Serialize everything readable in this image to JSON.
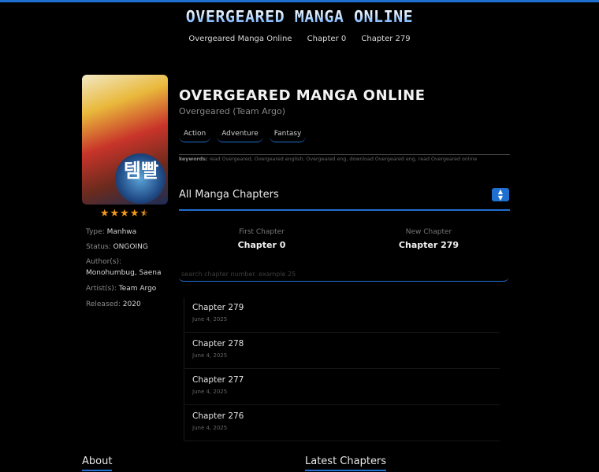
{
  "site": {
    "logo": "OVERGEARED MANGA ONLINE"
  },
  "nav": [
    "Overgeared Manga Online",
    "Chapter 0",
    "Chapter 279"
  ],
  "manga": {
    "title": "OVERGEARED MANGA ONLINE",
    "subtitle": "Overgeared (Team Argo)",
    "cover_text": "템빨",
    "rating_stars": 4.5,
    "genres": [
      "Action",
      "Adventure",
      "Fantasy"
    ],
    "keywords_label": "keywords:",
    "keywords": "read Overgeared, Overgeared english, Overgeared eng, download Overgeared eng, read Overgeared online"
  },
  "meta": {
    "type_label": "Type:",
    "type": "Manhwa",
    "status_label": "Status:",
    "status": "ONGOING",
    "author_label": "Author(s):",
    "author": "Monohumbug, Saena",
    "artist_label": "Artist(s):",
    "artist": "Team Argo",
    "released_label": "Released:",
    "released": "2020"
  },
  "chapters": {
    "heading": "All Manga Chapters",
    "first_label": "First Chapter",
    "first": "Chapter 0",
    "new_label": "New Chapter",
    "new": "Chapter 279",
    "search_placeholder": "search chapter number. example 25",
    "list": [
      {
        "name": "Chapter 279",
        "date": "June 4, 2025"
      },
      {
        "name": "Chapter 278",
        "date": "June 4, 2025"
      },
      {
        "name": "Chapter 277",
        "date": "June 4, 2025"
      },
      {
        "name": "Chapter 276",
        "date": "June 4, 2025"
      }
    ]
  },
  "footer": {
    "about": "About",
    "latest": "Latest Chapters"
  },
  "colors": {
    "accent": "#1f6fd1",
    "star": "#f39a1c",
    "background": "#000000"
  }
}
